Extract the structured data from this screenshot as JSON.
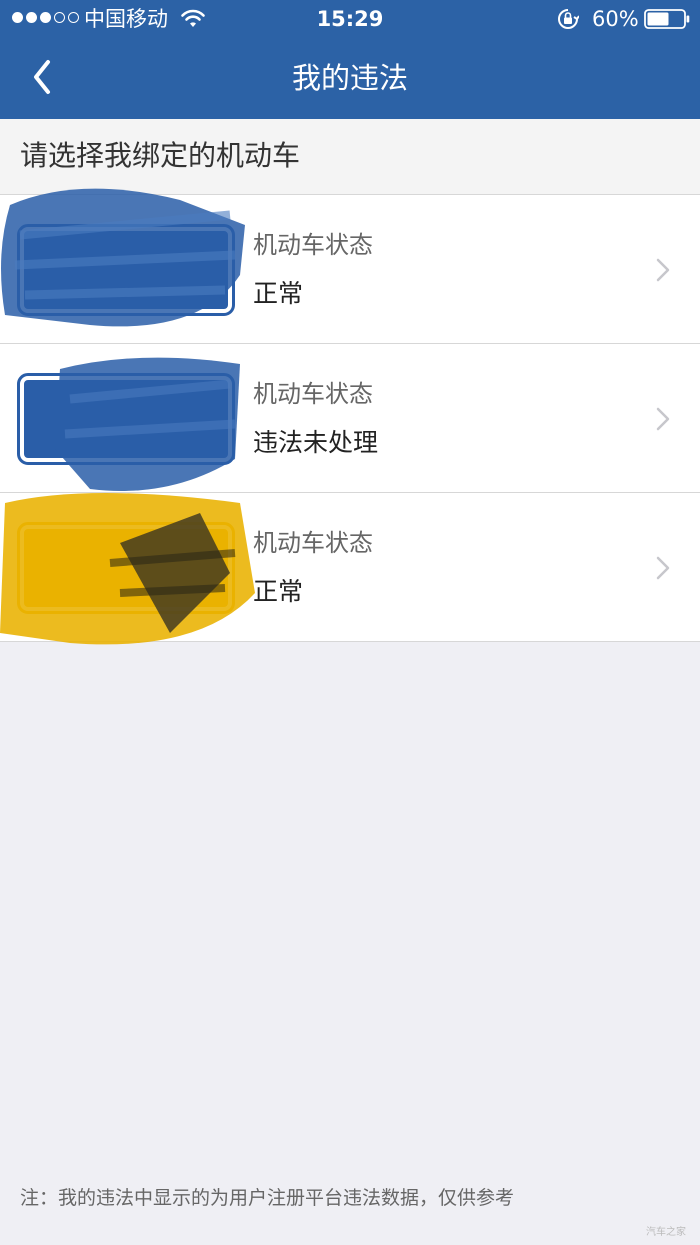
{
  "status_bar": {
    "carrier": "中国移动",
    "time": "15:29",
    "battery": "60%",
    "battery_level": 0.6,
    "signal_bars_filled": 3,
    "signal_bars_total": 5
  },
  "nav": {
    "title": "我的违法",
    "back_icon": "chevron-left-icon"
  },
  "section": {
    "title": "请选择我绑定的机动车"
  },
  "vehicles": [
    {
      "plate_color": "blue",
      "status_label": "机动车状态",
      "status_value": "正常"
    },
    {
      "plate_color": "blue",
      "status_label": "机动车状态",
      "status_value": "违法未处理"
    },
    {
      "plate_color": "yellow",
      "status_label": "机动车状态",
      "status_value": "正常"
    }
  ],
  "footnote": "注：我的违法中显示的为用户注册平台违法数据，仅供参考",
  "watermark": "汽车之家",
  "colors": {
    "brand_blue": "#2c62a6",
    "plate_blue": "#2a5ea8",
    "plate_yellow": "#e9b200",
    "background": "#efeff4"
  }
}
